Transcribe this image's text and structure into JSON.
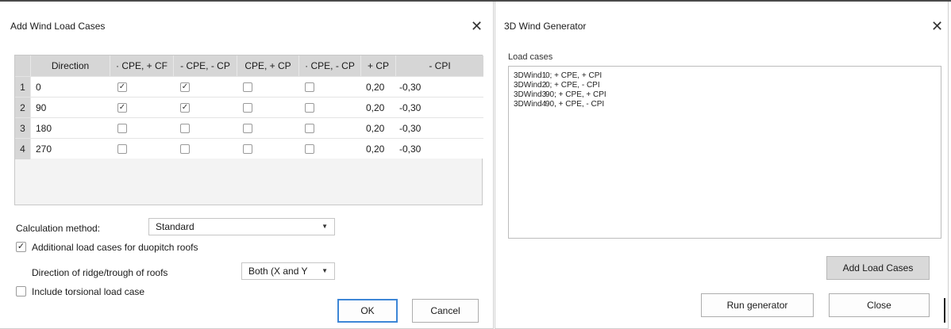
{
  "left_dialog": {
    "title": "Add Wind Load Cases",
    "close_icon": "close-icon",
    "grid": {
      "headers": [
        "Direction",
        "· CPE, + CF",
        "- CPE, - CP",
        "CPE, + CP",
        "· CPE, - CP",
        "+ CP",
        "- CPI"
      ],
      "rows": [
        {
          "index": "1",
          "direction": "0",
          "c1": true,
          "c2": true,
          "c3": false,
          "c4": false,
          "cpi_plus": "0,20",
          "cpi_minus": "-0,30"
        },
        {
          "index": "2",
          "direction": "90",
          "c1": true,
          "c2": true,
          "c3": false,
          "c4": false,
          "cpi_plus": "0,20",
          "cpi_minus": "-0,30"
        },
        {
          "index": "3",
          "direction": "180",
          "c1": false,
          "c2": false,
          "c3": false,
          "c4": false,
          "cpi_plus": "0,20",
          "cpi_minus": "-0,30"
        },
        {
          "index": "4",
          "direction": "270",
          "c1": false,
          "c2": false,
          "c3": false,
          "c4": false,
          "cpi_plus": "0,20",
          "cpi_minus": "-0,30"
        }
      ]
    },
    "calculation_method_label": "Calculation method:",
    "calculation_method_value": "Standard",
    "duopitch_label": "Additional load cases for duopitch roofs",
    "duopitch_checked": true,
    "ridge_label": "Direction of ridge/trough of roofs",
    "ridge_value": "Both (X and Y",
    "torsional_label": "Include torsional load case",
    "torsional_checked": false,
    "ok_label": "OK",
    "cancel_label": "Cancel"
  },
  "right_dialog": {
    "title": "3D Wind Generator",
    "close_icon": "close-icon",
    "load_cases_label": "Load cases",
    "load_cases": [
      {
        "id": "3DWind1",
        "desc": "0; + CPE, + CPI"
      },
      {
        "id": "3DWind2",
        "desc": "0; + CPE, - CPI"
      },
      {
        "id": "3DWind3",
        "desc": "90; + CPE, + CPI"
      },
      {
        "id": "3DWind4",
        "desc": "90, + CPE, - CPI"
      }
    ],
    "add_load_cases_label": "Add Load Cases",
    "run_generator_label": "Run generator",
    "close_label": "Close"
  },
  "colors": {
    "header_bg": "#d6d6d6",
    "ok_border": "#3d86d6",
    "add_button_bg": "#d9d9d9"
  }
}
